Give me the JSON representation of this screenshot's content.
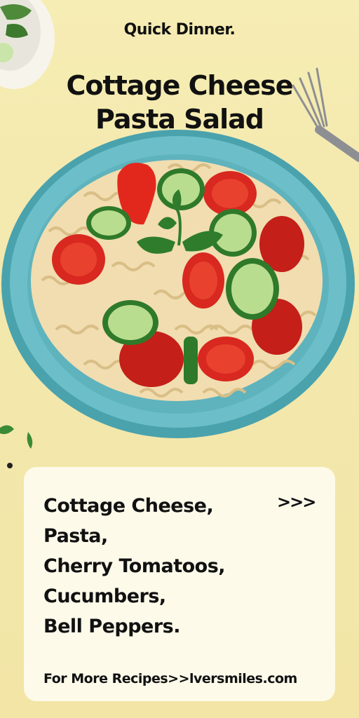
{
  "header": {
    "subtitle": "Quick Dinner.",
    "title_line1": "Cottage Cheese",
    "title_line2": "Pasta Salad"
  },
  "ingredients": {
    "items": [
      "Cottage Cheese,",
      "Pasta,",
      "Cherry Tomatoos,",
      "Cucumbers,",
      "Bell Peppers."
    ],
    "more_arrows": ">>>"
  },
  "footer": {
    "text": "For More Recipes>>lversmiles.com"
  },
  "colors": {
    "background": "#f4e9ae",
    "plate": "#5fb3bd",
    "card": "#fdfaea",
    "text": "#111111"
  }
}
